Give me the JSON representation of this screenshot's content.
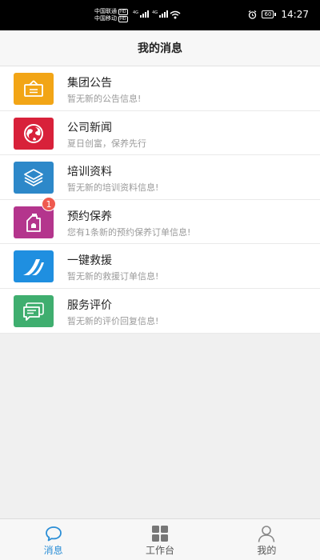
{
  "status_bar": {
    "carrier1": "中国联通",
    "carrier2": "中国移动",
    "hd": "HD",
    "network1": "4G",
    "network2": "4G",
    "battery": "60",
    "time": "14:27"
  },
  "header": {
    "title": "我的消息"
  },
  "messages": [
    {
      "title": "集团公告",
      "subtitle": "暂无新的公告信息!",
      "icon": "signboard-icon",
      "color": "#f2a516",
      "badge": ""
    },
    {
      "title": "公司新闻",
      "subtitle": "夏日创富，保养先行",
      "icon": "globe-icon",
      "color": "#d8213a",
      "badge": ""
    },
    {
      "title": "培训资料",
      "subtitle": "暂无新的培训资料信息!",
      "icon": "layers-icon",
      "color": "#2d88c9",
      "badge": ""
    },
    {
      "title": "预约保养",
      "subtitle": "您有1条新的预约保养订单信息!",
      "icon": "oil-can-icon",
      "color": "#b4358d",
      "badge": "1"
    },
    {
      "title": "一键救援",
      "subtitle": "暂无新的救援订单信息!",
      "icon": "road-icon",
      "color": "#1f8fe0",
      "badge": ""
    },
    {
      "title": "服务评价",
      "subtitle": "暂无新的评价回复信息!",
      "icon": "comment-icon",
      "color": "#3fae6f",
      "badge": ""
    }
  ],
  "tabs": [
    {
      "label": "消息",
      "icon": "chat-icon",
      "active": true
    },
    {
      "label": "工作台",
      "icon": "grid-icon",
      "active": false
    },
    {
      "label": "我的",
      "icon": "user-icon",
      "active": false
    }
  ],
  "colors": {
    "accent": "#2b8ed6",
    "badge": "#ef5a4f"
  }
}
